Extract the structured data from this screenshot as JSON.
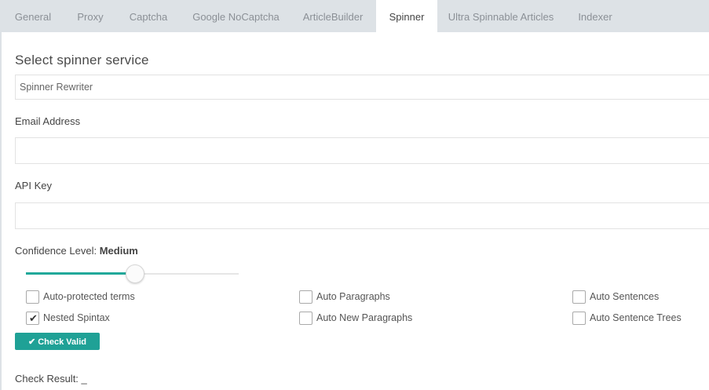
{
  "tabs": [
    {
      "label": "General",
      "active": false
    },
    {
      "label": "Proxy",
      "active": false
    },
    {
      "label": "Captcha",
      "active": false
    },
    {
      "label": "Google NoCaptcha",
      "active": false
    },
    {
      "label": "ArticleBuilder",
      "active": false
    },
    {
      "label": "Spinner",
      "active": true
    },
    {
      "label": "Ultra Spinnable Articles",
      "active": false
    },
    {
      "label": "Indexer",
      "active": false
    }
  ],
  "spinner_section": {
    "title": "Select spinner service",
    "selected_service": "Spinner Rewriter"
  },
  "email": {
    "label": "Email Address",
    "value": "",
    "placeholder": ""
  },
  "api_key": {
    "label": "API Key",
    "value": "",
    "placeholder": ""
  },
  "confidence": {
    "label": "Confidence Level:",
    "value_label": "Medium",
    "slider_fraction": 0.5
  },
  "options": [
    {
      "label": "Auto-protected terms",
      "checked": false
    },
    {
      "label": "Auto Paragraphs",
      "checked": false
    },
    {
      "label": "Auto Sentences",
      "checked": false
    },
    {
      "label": "Nested Spintax",
      "checked": true
    },
    {
      "label": "Auto New Paragraphs",
      "checked": false
    },
    {
      "label": "Auto Sentence Trees",
      "checked": false
    }
  ],
  "check_button": {
    "label": "Check Valid",
    "icon": "check-icon"
  },
  "check_result": {
    "label": "Check Result:",
    "value": "_"
  },
  "colors": {
    "accent": "#1fa196",
    "tabbar_bg": "#dde2e6"
  }
}
